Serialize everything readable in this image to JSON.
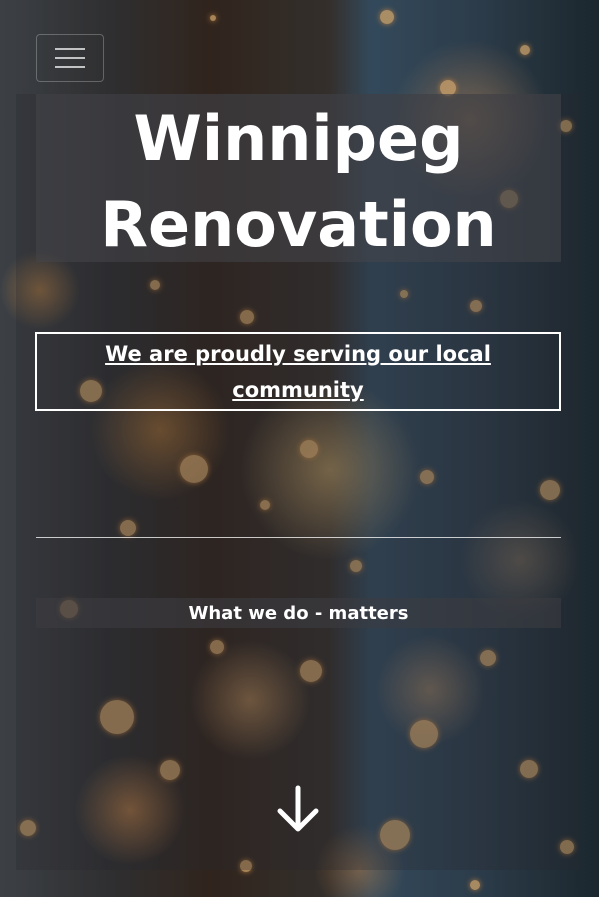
{
  "header": {
    "menu_icon": "hamburger-menu-icon"
  },
  "hero": {
    "title": "Winnipeg Renovation",
    "tagline": "We are proudly serving our local community",
    "subheading": "What we do - matters",
    "scroll_icon": "arrow-down-icon"
  },
  "colors": {
    "text": "#ffffff",
    "accent_glow": "#f0a050"
  }
}
